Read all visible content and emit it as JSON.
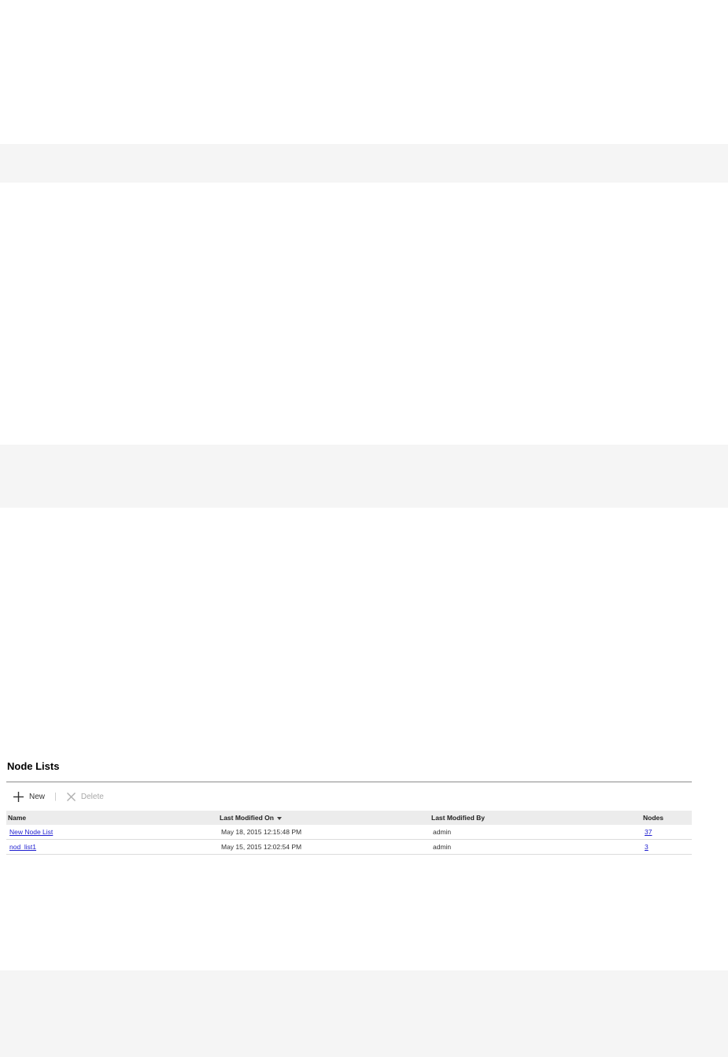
{
  "panel": {
    "title": "Node Lists"
  },
  "toolbar": {
    "new_label": "New",
    "new_icon": "plus-icon",
    "separator": "|",
    "delete_label": "Delete",
    "delete_icon": "x-icon",
    "delete_enabled": false
  },
  "table": {
    "columns": [
      "Name",
      "Last Modified On",
      "Last Modified By",
      "Nodes"
    ],
    "sort": {
      "column": "Last Modified On",
      "direction": "descending"
    },
    "rows": [
      {
        "name": "New Node List",
        "modified_on": "May 18, 2015 12:15:48 PM",
        "modified_by": "admin",
        "nodes": "37"
      },
      {
        "name": "nod_list1",
        "modified_on": "May 15, 2015 12:02:54 PM",
        "modified_by": "admin",
        "nodes": "3"
      }
    ]
  },
  "colors": {
    "link": "#1f1fd0",
    "header_bg": "#ececec",
    "band_bg": "#f5f5f5"
  }
}
